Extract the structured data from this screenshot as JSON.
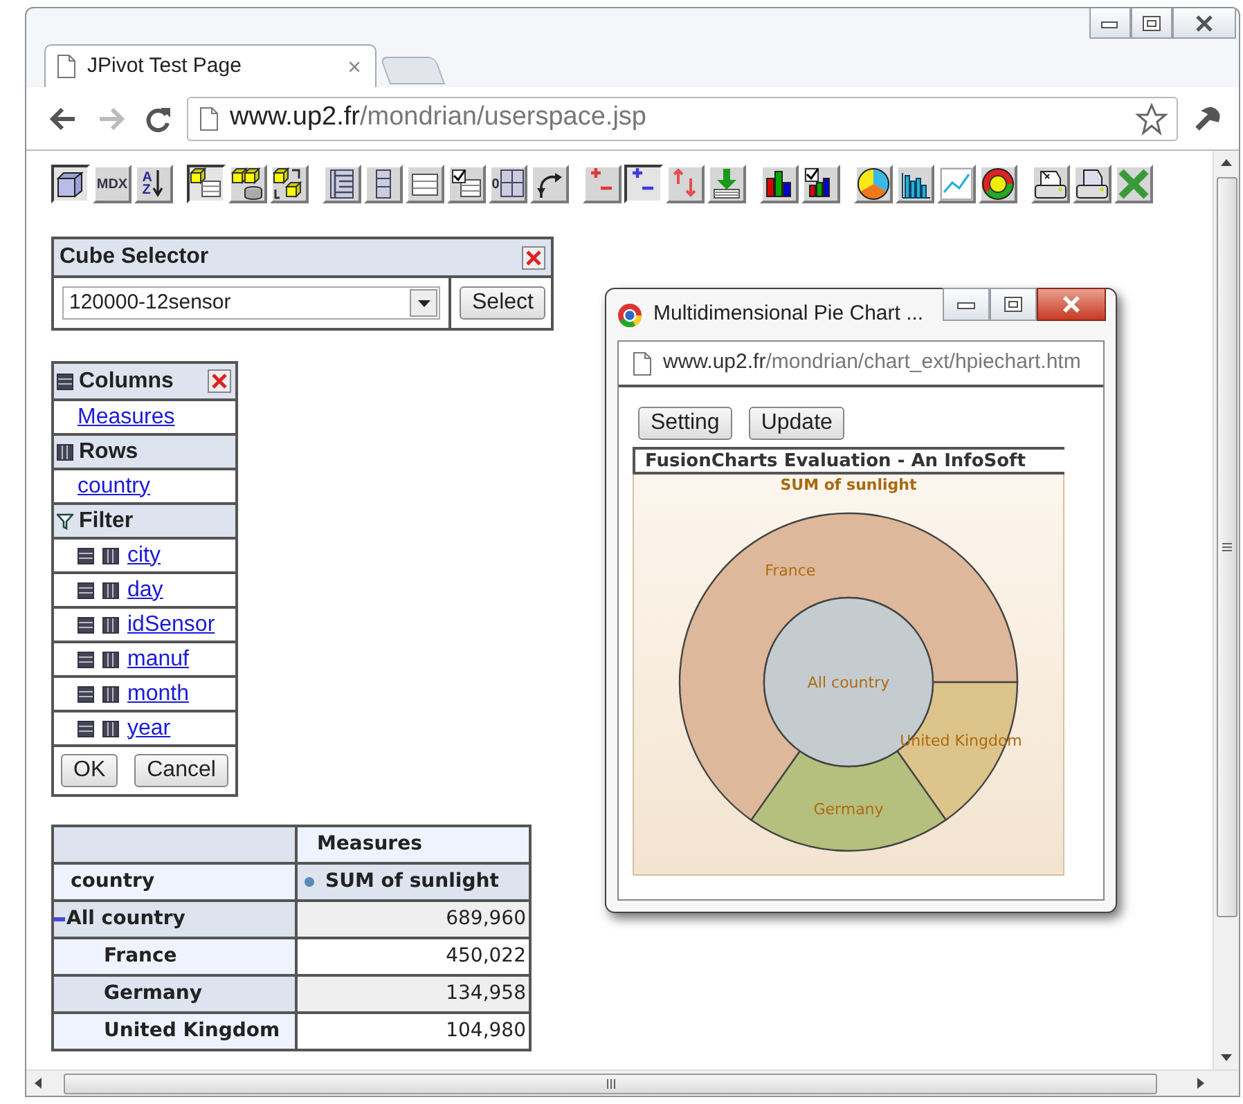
{
  "tab": {
    "title": "JPivot Test Page",
    "close": "×"
  },
  "nav_buttons": [
    {
      "kind": "back",
      "disabled": false
    },
    {
      "kind": "forward",
      "disabled": true
    },
    {
      "kind": "reload",
      "disabled": false
    }
  ],
  "address_bar": {
    "host": "www.up2.fr",
    "path": "/mondrian/userspace.jsp"
  },
  "toolbar": [
    {
      "items": [
        {
          "kind": "cube",
          "pressed": true
        },
        {
          "kind": "mdx",
          "label": "MDX",
          "pressed": false
        },
        {
          "kind": "sort",
          "label": "AZ",
          "pressed": false
        }
      ]
    },
    {
      "items": [
        {
          "kind": "navigator",
          "pressed": true
        },
        {
          "kind": "drill",
          "pressed": false
        },
        {
          "kind": "swap",
          "pressed": false
        }
      ]
    },
    {
      "items": [
        {
          "kind": "tree",
          "pressed": false
        },
        {
          "kind": "column",
          "pressed": false
        },
        {
          "kind": "grid",
          "pressed": false
        },
        {
          "kind": "check-table",
          "pressed": false
        },
        {
          "kind": "zero-grid",
          "label": "0",
          "pressed": false
        },
        {
          "kind": "curve-arrow",
          "pressed": false
        }
      ]
    },
    {
      "items": [
        {
          "kind": "plus-minus-red",
          "pressed": false
        },
        {
          "kind": "plus-minus-blue",
          "pressed": true
        },
        {
          "kind": "up-down",
          "pressed": false
        },
        {
          "kind": "download",
          "pressed": false
        }
      ]
    },
    {
      "items": [
        {
          "kind": "bar-chart",
          "pressed": false
        },
        {
          "kind": "bar-check",
          "pressed": false
        }
      ]
    },
    {
      "items": [
        {
          "kind": "pie",
          "pressed": false
        },
        {
          "kind": "bars-blue",
          "pressed": false
        },
        {
          "kind": "line",
          "pressed": false
        },
        {
          "kind": "donut",
          "pressed": false
        }
      ]
    },
    {
      "items": [
        {
          "kind": "print-setup",
          "pressed": false
        },
        {
          "kind": "printer",
          "pressed": false
        },
        {
          "kind": "spreadsheet",
          "pressed": false
        }
      ]
    }
  ],
  "cube_selector": {
    "title": "Cube Selector",
    "cube": "120000-12sensor",
    "button": "Select"
  },
  "navigator": {
    "sections": [
      {
        "kind": "columns",
        "title": "Columns",
        "closable": true,
        "items": [
          {
            "label": "Measures"
          }
        ]
      },
      {
        "kind": "rows",
        "title": "Rows",
        "closable": false,
        "items": [
          {
            "label": "country"
          }
        ]
      },
      {
        "kind": "filter",
        "title": "Filter",
        "closable": false,
        "items": [
          {
            "label": "city"
          },
          {
            "label": "day"
          },
          {
            "label": "idSensor"
          },
          {
            "label": "manuf"
          },
          {
            "label": "month"
          },
          {
            "label": "year"
          }
        ]
      }
    ],
    "buttons": [
      "OK",
      "Cancel"
    ]
  },
  "pivot_table": {
    "column_header": "Measures",
    "row_header": "country",
    "measure": "SUM of sunlight",
    "rows": [
      {
        "label": "All country",
        "value": "689,960",
        "expanded": true,
        "children": [
          {
            "label": "France",
            "value": "450,022"
          },
          {
            "label": "Germany",
            "value": "134,958"
          },
          {
            "label": "United Kingdom",
            "value": "104,980"
          }
        ]
      }
    ]
  },
  "popup": {
    "title": "Multidimensional Pie Chart ...",
    "host": "www.up2.fr",
    "path": "/mondrian/chart_ext/hpiechart.htm",
    "buttons": [
      "Setting",
      "Update"
    ],
    "banner": "FusionCharts Evaluation - An InfoSoft",
    "chart": {
      "title": "SUM of sunlight",
      "center_label": "All country",
      "segments": [
        {
          "label": "France",
          "color": "#deb89a"
        },
        {
          "label": "Germany",
          "color": "#b5bf7e"
        },
        {
          "label": "United Kingdom",
          "color": "#dcc48a"
        }
      ]
    }
  }
}
